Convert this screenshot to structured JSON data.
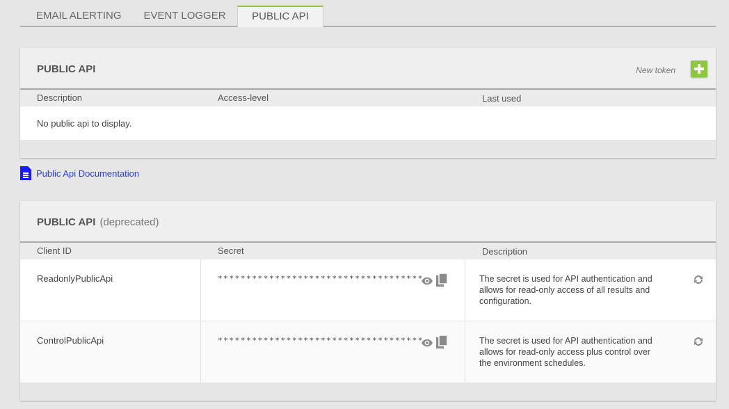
{
  "tabs": [
    "EMAIL ALERTING",
    "EVENT LOGGER",
    "PUBLIC API"
  ],
  "public_api": {
    "title": "PUBLIC API",
    "new_token_label": "New token",
    "columns": [
      "Description",
      "Access-level",
      "Last used"
    ],
    "empty_message": "No public api to display."
  },
  "doc_link": {
    "label": "Public Api Documentation"
  },
  "deprecated": {
    "title": "PUBLIC API",
    "subtitle": "(deprecated)",
    "columns": [
      "Client ID",
      "Secret",
      "Description"
    ],
    "rows": [
      {
        "client_id": "ReadonlyPublicApi",
        "secret": "************************************",
        "description": "The secret is used for API authentication and allows for read-only access of all results and configuration."
      },
      {
        "client_id": "ControlPublicApi",
        "secret": "************************************",
        "description": "The secret is used for API authentication and allows for read-only access plus control over the environment schedules."
      }
    ]
  },
  "colors": {
    "accent": "#8dc63f",
    "link": "#2b3fd6",
    "doc_icon": "#1a1aff"
  },
  "icons": [
    "plus-icon",
    "document-icon",
    "eye-icon",
    "copy-icon",
    "refresh-icon"
  ]
}
